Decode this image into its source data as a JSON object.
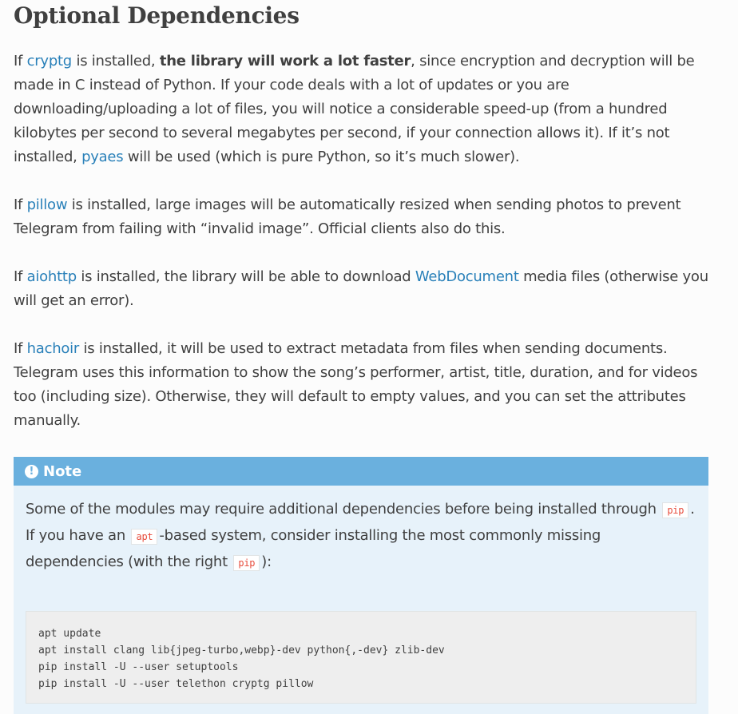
{
  "section_title": "Optional Dependencies",
  "paragraphs": [
    {
      "pre": "If ",
      "link": "cryptg",
      "mid1": " is installed, ",
      "bold": "the library will work a lot faster",
      "post": ", since encryption and decryption will be made in C instead of Python. If your code deals with a lot of updates or you are downloading/uploading a lot of files, you will notice a considerable speed-up (from a hundred kilobytes per second to several megabytes per second, if your connection allows it). If it’s not installed, ",
      "link2": "pyaes",
      "post2": " will be used (which is pure Python, so it’s much slower)."
    },
    {
      "pre": "If ",
      "link": "pillow",
      "post": " is installed, large images will be automatically resized when sending photos to prevent Telegram from failing with “invalid image”. Official clients also do this."
    },
    {
      "pre": "If ",
      "link": "aiohttp",
      "mid": " is installed, the library will be able to download ",
      "link2": "WebDocument",
      "post": " media files (otherwise you will get an error)."
    },
    {
      "pre": "If ",
      "link": "hachoir",
      "post": " is installed, it will be used to extract metadata from files when sending documents. Telegram uses this information to show the song’s performer, artist, title, duration, and for videos too (including size). Otherwise, they will default to empty values, and you can set the attributes manually."
    }
  ],
  "note": {
    "icon": "!",
    "title": "Note",
    "text1": "Some of the modules may require additional dependencies before being installed through ",
    "code1": "pip",
    "text2": ". If you have an ",
    "code2": "apt",
    "text3": "-based system, consider installing the most commonly missing dependencies (with the right ",
    "code3": "pip",
    "text4": "):",
    "code_lines": [
      "apt update",
      "apt install clang lib{jpeg-turbo,webp}-dev python{,-dev} zlib-dev",
      "pip install -U --user setuptools",
      "pip install -U --user telethon cryptg pillow"
    ]
  }
}
